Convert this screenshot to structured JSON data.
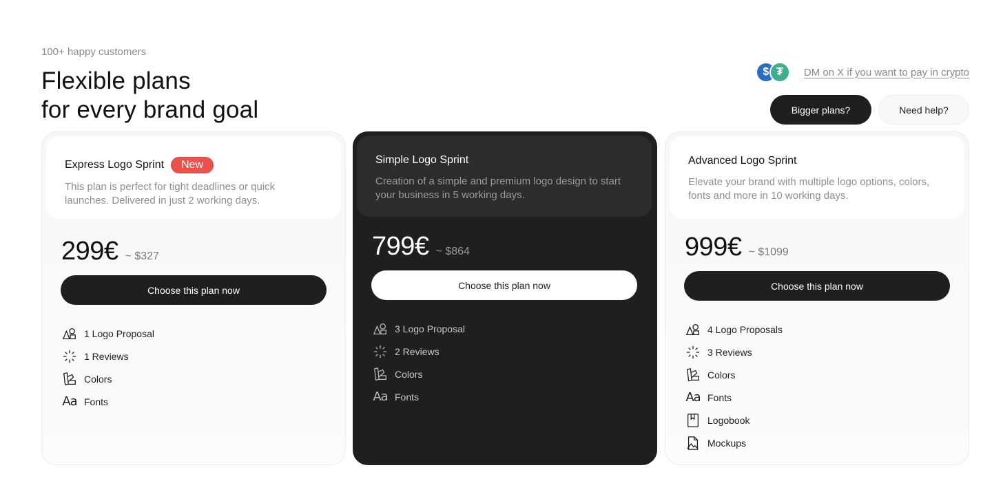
{
  "header": {
    "eyebrow": "100+ happy customers",
    "title_line1": "Flexible plans",
    "title_line2": "for every brand goal",
    "crypto_link": "DM on X if you want to pay in crypto",
    "bigger_plans_label": "Bigger plans?",
    "need_help_label": "Need help?"
  },
  "plans": [
    {
      "title": "Express Logo Sprint",
      "badge": "New",
      "description": "This plan is perfect for tight deadlines or quick launches. Delivered in just 2 working days.",
      "price": "299€",
      "usd": "~ $327",
      "cta": "Choose this plan now",
      "features": [
        {
          "icon": "shapes-icon",
          "label": "1 Logo Proposal"
        },
        {
          "icon": "loader-icon",
          "label": "1 Reviews"
        },
        {
          "icon": "swatch-icon",
          "label": "Colors"
        },
        {
          "icon": "font-icon",
          "label": "Fonts"
        }
      ]
    },
    {
      "title": "Simple Logo Sprint",
      "description": "Creation of a simple and premium logo design to start your business in 5 working days.",
      "price": "799€",
      "usd": "~ $864",
      "cta": "Choose this plan now",
      "features": [
        {
          "icon": "shapes-icon",
          "label": "3 Logo Proposal"
        },
        {
          "icon": "loader-icon",
          "label": "2 Reviews"
        },
        {
          "icon": "swatch-icon",
          "label": "Colors"
        },
        {
          "icon": "font-icon",
          "label": "Fonts"
        }
      ]
    },
    {
      "title": "Advanced Logo Sprint",
      "description": "Elevate your brand with multiple logo options, colors, fonts and more in 10 working days.",
      "price": "999€",
      "usd": "~ $1099",
      "cta": "Choose this plan now",
      "features": [
        {
          "icon": "shapes-icon",
          "label": "4 Logo Proposals"
        },
        {
          "icon": "loader-icon",
          "label": "3 Reviews"
        },
        {
          "icon": "swatch-icon",
          "label": "Colors"
        },
        {
          "icon": "font-icon",
          "label": "Fonts"
        },
        {
          "icon": "book-icon",
          "label": "Logobook"
        },
        {
          "icon": "image-file-icon",
          "label": "Mockups"
        }
      ]
    }
  ],
  "colors": {
    "dark": "#1f1f1f",
    "dark_panel": "#2d2d2d",
    "badge_red": "#e9534c",
    "muted_text": "#8a8a8a",
    "usdc_blue": "#2b6cc4",
    "usdt_green": "#3fae8e"
  }
}
